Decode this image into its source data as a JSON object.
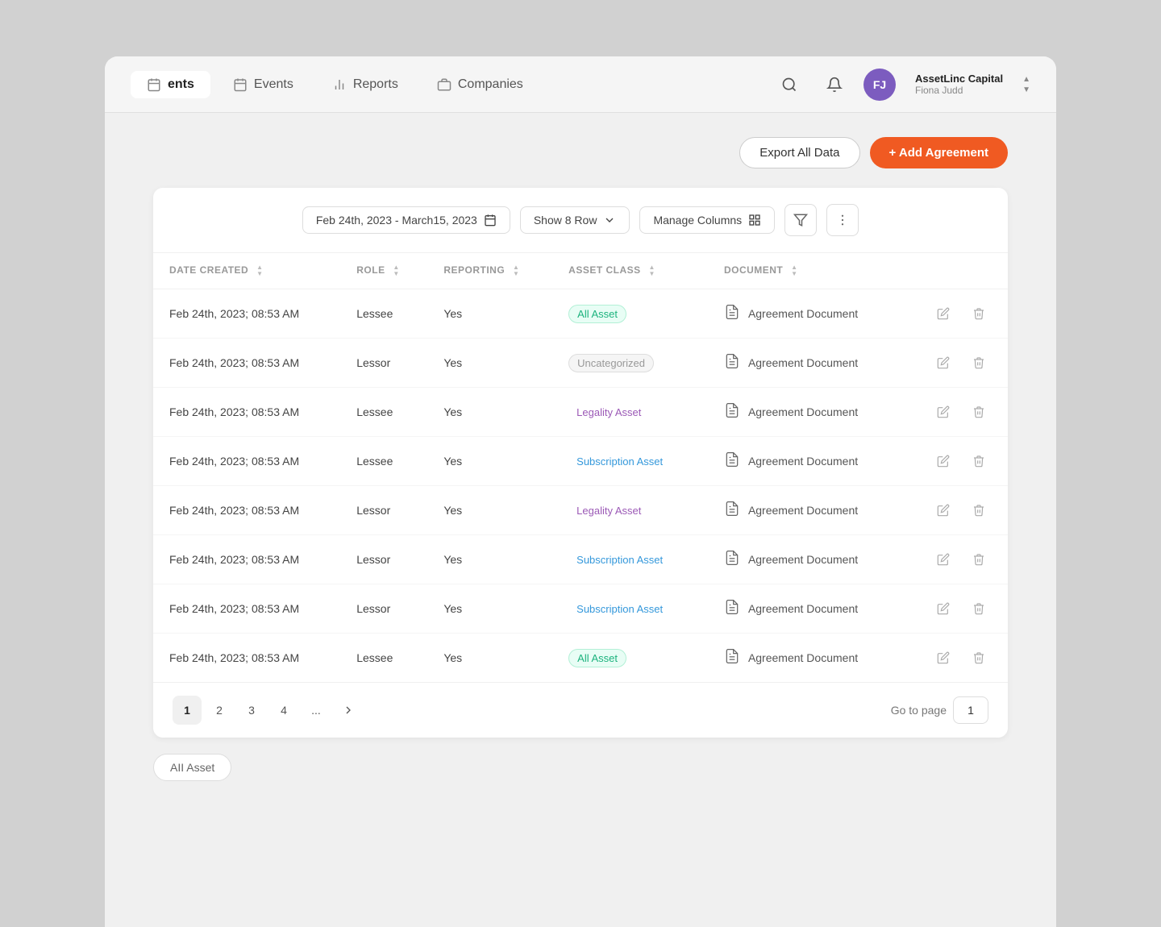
{
  "nav": {
    "tabs": [
      {
        "label": "ents",
        "icon": "calendar",
        "active": true
      },
      {
        "label": "Events",
        "icon": "calendar",
        "active": false
      },
      {
        "label": "Reports",
        "icon": "bar-chart",
        "active": false
      },
      {
        "label": "Companies",
        "icon": "building",
        "active": false
      }
    ],
    "user": {
      "initials": "FJ",
      "company": "AssetLinc Capital",
      "name": "Fiona Judd"
    }
  },
  "toolbar": {
    "export_label": "Export All Data",
    "add_label": "+ Add Agreement"
  },
  "filters": {
    "date_range": "Feb 24th, 2023 - March15, 2023",
    "show_rows": "Show 8 Row",
    "manage_columns": "Manage Columns"
  },
  "table": {
    "columns": [
      {
        "key": "date_created",
        "label": "DATE CREATED"
      },
      {
        "key": "role",
        "label": "ROLE"
      },
      {
        "key": "reporting",
        "label": "REPORTING"
      },
      {
        "key": "asset_class",
        "label": "ASSET CLASS"
      },
      {
        "key": "document",
        "label": "DOCUMENT"
      }
    ],
    "rows": [
      {
        "date": "Feb 24th, 2023; 08:53 AM",
        "role": "Lessee",
        "reporting": "Yes",
        "asset_class": "All Asset",
        "asset_type": "allasset",
        "document": "Agreement Document"
      },
      {
        "date": "Feb 24th, 2023; 08:53 AM",
        "role": "Lessor",
        "reporting": "Yes",
        "asset_class": "Uncategorized",
        "asset_type": "uncategorized",
        "document": "Agreement Document"
      },
      {
        "date": "Feb 24th, 2023; 08:53 AM",
        "role": "Lessee",
        "reporting": "Yes",
        "asset_class": "Legality Asset",
        "asset_type": "legality",
        "document": "Agreement Document"
      },
      {
        "date": "Feb 24th, 2023; 08:53 AM",
        "role": "Lessee",
        "reporting": "Yes",
        "asset_class": "Subscription Asset",
        "asset_type": "subscription",
        "document": "Agreement Document"
      },
      {
        "date": "Feb 24th, 2023; 08:53 AM",
        "role": "Lessor",
        "reporting": "Yes",
        "asset_class": "Legality Asset",
        "asset_type": "legality",
        "document": "Agreement Document"
      },
      {
        "date": "Feb 24th, 2023; 08:53 AM",
        "role": "Lessor",
        "reporting": "Yes",
        "asset_class": "Subscription Asset",
        "asset_type": "subscription",
        "document": "Agreement Document"
      },
      {
        "date": "Feb 24th, 2023; 08:53 AM",
        "role": "Lessor",
        "reporting": "Yes",
        "asset_class": "Subscription Asset",
        "asset_type": "subscription",
        "document": "Agreement Document"
      },
      {
        "date": "Feb 24th, 2023; 08:53 AM",
        "role": "Lessee",
        "reporting": "Yes",
        "asset_class": "All Asset",
        "asset_type": "allasset",
        "document": "Agreement Document"
      }
    ]
  },
  "pagination": {
    "pages": [
      "1",
      "2",
      "3",
      "4"
    ],
    "current": "1",
    "goto_label": "Go to  page",
    "goto_value": "1",
    "more": "..."
  },
  "footer_tab": {
    "label": "AII Asset"
  }
}
